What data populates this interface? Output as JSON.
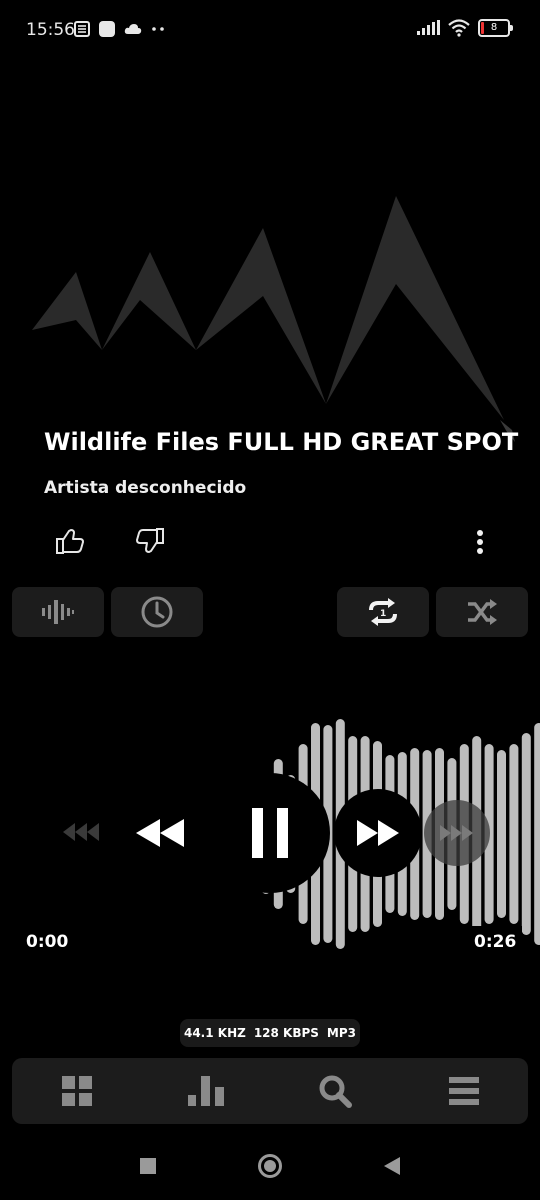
{
  "status": {
    "time": "15:56",
    "battery_level": "8",
    "left_icons": [
      "news-icon",
      "square-app-icon",
      "cloud-icon",
      "more-dots-icon"
    ],
    "right_icons": [
      "signal-icon",
      "wifi-icon",
      "battery-icon"
    ]
  },
  "track": {
    "title": "Wildlife Files FULL HD GREAT SPOT",
    "artist": "Artista desconhecido"
  },
  "playback": {
    "current_time": "0:00",
    "total_time": "0:26",
    "progress": 0.0,
    "state": "playing"
  },
  "format": {
    "sample_rate": "44.1 KHZ",
    "bitrate": "128 KBPS",
    "codec": "MP3"
  },
  "colors": {
    "background": "#000000",
    "panel": "#1c1c1c",
    "waveform": "#bdbdbd",
    "icon_dim": "#8a8a8a",
    "artwork": "#2a2a2a"
  },
  "bottom_nav": {
    "items": [
      "grid-icon",
      "bar-chart-icon",
      "search-icon",
      "menu-icon"
    ]
  }
}
